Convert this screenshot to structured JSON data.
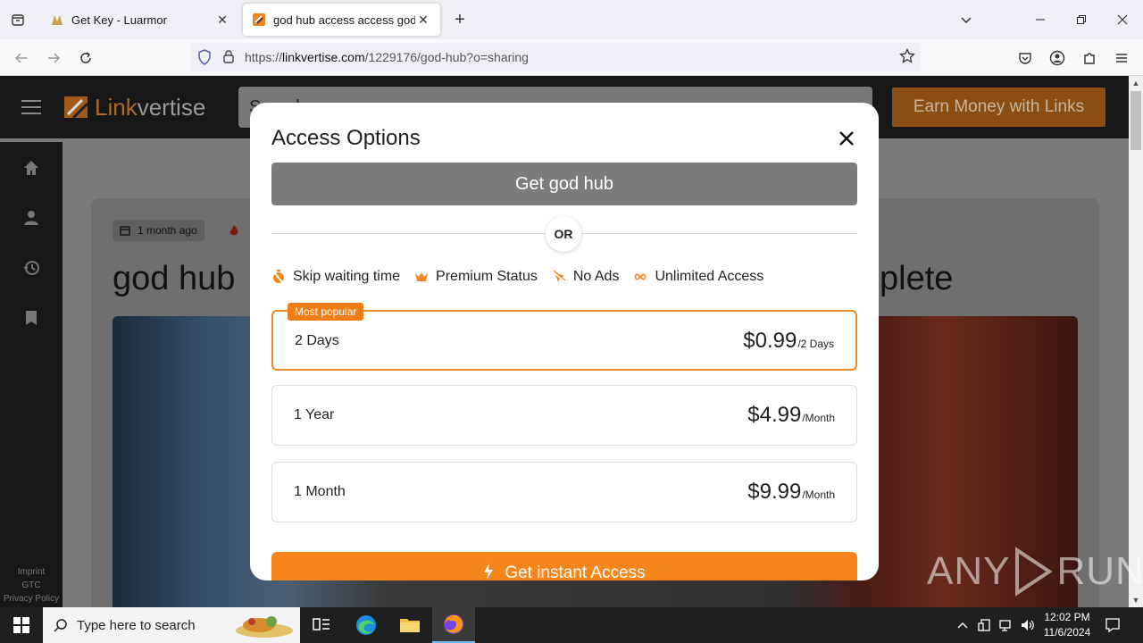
{
  "browser": {
    "tabs": [
      {
        "title": "Get Key - Luarmor",
        "active": false
      },
      {
        "title": "god hub access access god hub",
        "active": true
      }
    ],
    "new_tab_symbol": "+",
    "url_prefix": "https://",
    "url_domain": "linkvertise.com",
    "url_path": "/1229176/god-hub?o=sharing"
  },
  "site": {
    "logo_first": "Link",
    "logo_second": "vertise",
    "search_placeholder": "Search",
    "earn_button": "Earn Money with Links",
    "sidebar_links": [
      "Imprint",
      "GTC",
      "Privacy Policy"
    ],
    "meta_time": "1 month ago",
    "title_left": "god hub",
    "title_right": "plete"
  },
  "modal": {
    "title": "Access Options",
    "get_button": "Get god hub",
    "or_label": "OR",
    "features": [
      {
        "icon": "timer-off-icon",
        "label": "Skip waiting time"
      },
      {
        "icon": "crown-icon",
        "label": "Premium Status"
      },
      {
        "icon": "no-ads-icon",
        "label": "No Ads"
      },
      {
        "icon": "infinity-icon",
        "label": "Unlimited Access"
      }
    ],
    "plans": [
      {
        "badge": "Most popular",
        "name": "2 Days",
        "price": "$0.99",
        "period": "/2 Days",
        "selected": true
      },
      {
        "name": "1 Year",
        "price": "$4.99",
        "period": "/Month",
        "selected": false
      },
      {
        "name": "1 Month",
        "price": "$9.99",
        "period": "/Month",
        "selected": false
      }
    ],
    "instant_button": "Get instant Access"
  },
  "watermark": {
    "left": "ANY",
    "right": "RUN"
  },
  "taskbar": {
    "search_placeholder": "Type here to search",
    "time": "12:02 PM",
    "date": "11/6/2024"
  },
  "colors": {
    "accent_orange": "#f6861b",
    "popular_border": "#ef8b2a",
    "get_button_gray": "#7c7c7c"
  }
}
